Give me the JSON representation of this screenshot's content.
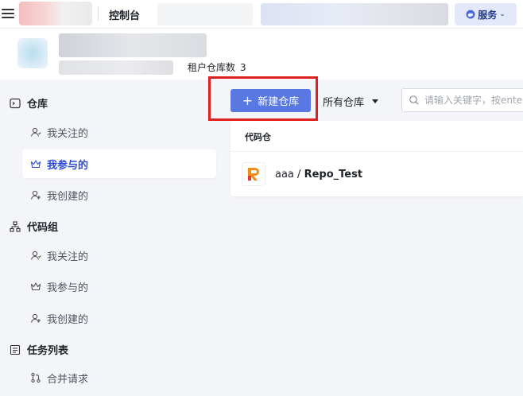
{
  "topbar": {
    "console_label": "控制台",
    "service_label": "服务"
  },
  "header": {
    "tenant_label": "租户仓库数",
    "tenant_count": "3"
  },
  "sidebar": {
    "groups": [
      {
        "title": "仓库",
        "icon": "terminal-icon",
        "items": [
          {
            "label": "我关注的",
            "icon": "user-follow-icon"
          },
          {
            "label": "我参与的",
            "icon": "crown-icon",
            "active": true
          },
          {
            "label": "我创建的",
            "icon": "user-create-icon"
          }
        ]
      },
      {
        "title": "代码组",
        "icon": "group-tree-icon",
        "items": [
          {
            "label": "我关注的",
            "icon": "user-follow-icon"
          },
          {
            "label": "我参与的",
            "icon": "crown-icon"
          },
          {
            "label": "我创建的",
            "icon": "user-create-icon"
          }
        ]
      },
      {
        "title": "任务列表",
        "icon": "task-list-icon",
        "items": [
          {
            "label": "合并请求",
            "icon": "merge-request-icon"
          }
        ]
      }
    ]
  },
  "toolbar": {
    "new_repo_label": "新建仓库",
    "filter_label": "所有仓库",
    "search_placeholder": "请输入关键字，按enter"
  },
  "repo_list": {
    "header": "代码仓",
    "repos": [
      {
        "owner": "aaa",
        "separator": " / ",
        "name": "Repo_Test"
      }
    ]
  },
  "colors": {
    "primary": "#5a78e2",
    "active_text": "#2b4bd6",
    "highlight_border": "#e0201e"
  }
}
